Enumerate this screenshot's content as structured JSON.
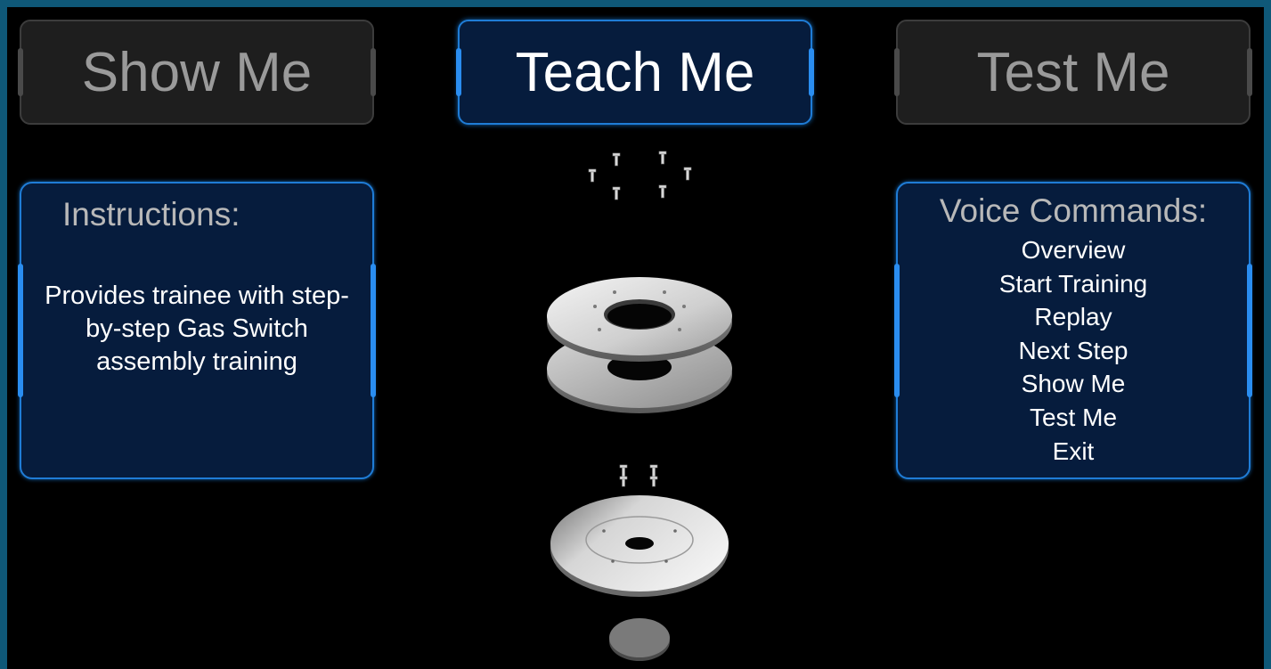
{
  "modes": {
    "show_me": "Show Me",
    "teach_me": "Teach Me",
    "test_me": "Test Me",
    "active": "teach_me"
  },
  "instructions": {
    "title": "Instructions:",
    "text": "Provides trainee with step-by-step Gas Switch assembly training"
  },
  "voice_commands": {
    "title": "Voice Commands:",
    "items": [
      "Overview",
      "Start Training",
      "Replay",
      "Next Step",
      "Show Me",
      "Test Me",
      "Exit"
    ]
  },
  "model": {
    "name": "Gas Switch assembly",
    "parts": [
      "top-screws",
      "upper-ring-plate",
      "lower-ring-plate",
      "middle-screws",
      "base-plate",
      "center-disc"
    ]
  },
  "colors": {
    "frame": "#0f5878",
    "active_border": "#1f7cd6",
    "panel_fill": "#061c3d",
    "inactive_fill": "#1e1e1e",
    "inactive_text": "#9a9a9a"
  }
}
